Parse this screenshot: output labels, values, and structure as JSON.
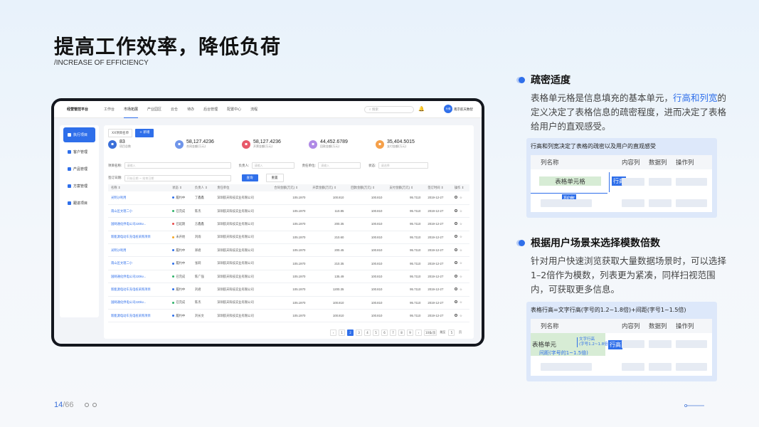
{
  "page": {
    "title": "提高工作效率，降低负荷",
    "subtitle": "/INCREASE OF EFFICIENCY",
    "page_current": "14",
    "page_total": "/66"
  },
  "app": {
    "brand": "经营管控平台",
    "nav": [
      "工作台",
      "市场拓展",
      "产业园区",
      "云仓",
      "待办",
      "后台管理",
      "配置中心",
      "流程"
    ],
    "nav_active": 1,
    "search_placeholder": "搜索",
    "avatar_text": "头像",
    "user": "南京航天数智",
    "sidebar": [
      {
        "label": "执行项目",
        "active": true
      },
      {
        "label": "客户管理",
        "active": false
      },
      {
        "label": "产品管理",
        "active": false
      },
      {
        "label": "方案管理",
        "active": false
      },
      {
        "label": "跟进项目",
        "active": false
      }
    ],
    "btn_import": "XX项目名单",
    "btn_new": "+ 新增",
    "stats": [
      {
        "value": "83",
        "label": "项目总数",
        "color": "#3a6fd9",
        "icon": "doc-icon"
      },
      {
        "value": "58,127.4236",
        "label": "合同金额(万元)",
        "color": "#6f95ea",
        "icon": "coin-icon"
      },
      {
        "value": "58,127.4236",
        "label": "开票金额(万元)",
        "color": "#e8596a",
        "icon": "ticket-icon"
      },
      {
        "value": "44,452.6789",
        "label": "回款金额(万元)",
        "color": "#b08ae6",
        "icon": "wallet-icon"
      },
      {
        "value": "35,404.5015",
        "label": "支付金额(万元)",
        "color": "#f5a04a",
        "icon": "pay-icon"
      }
    ],
    "filters": {
      "name_label": "项目名称:",
      "name_ph": "请输入",
      "owner_label": "负责人:",
      "owner_ph": "请输入",
      "unit_label": "责任单位:",
      "unit_ph": "请输入",
      "status_label": "状态:",
      "status_ph": "请选择",
      "date_label": "签订日期:",
      "date_ph": "开始日期 ~ 结束日期",
      "query": "查询",
      "reset": "重置"
    },
    "columns": [
      "名称 ⇕",
      "状态 ⇕",
      "负责人 ⇕",
      "责任单位",
      "合同金额(万元) ⇕",
      "开票金额(万元) ⇕",
      "回款金额(万元) ⇕",
      "支付金额(万元) ⇕",
      "签订时间 ⇕",
      "操作 ⇕"
    ],
    "rows": [
      [
        "光明沙利用",
        "履约中",
        "丁鑫鑫",
        "深圳航天科技实业有限公司",
        "105.1970",
        "100.810",
        "100.810",
        "95.7110",
        "2019-12-27"
      ],
      [
        "南山区文理二小",
        "已完成",
        "陈杰",
        "深圳航天科技实业有限公司",
        "105.1970",
        "110.85",
        "100.810",
        "95.7110",
        "2019-12-27"
      ],
      [
        "国网通化供电公司220kv...",
        "已延期",
        "方鑫鑫",
        "深圳航天科技实业有限公司",
        "105.1970",
        "200.35",
        "100.810",
        "95.7110",
        "2019-12-27"
      ],
      [
        "新能源电动车充电桩采购项目",
        "未开始",
        "刘雨",
        "深圳航天科技实业有限公司",
        "105.1970",
        "210.60",
        "100.810",
        "95.7110",
        "2019-12-27"
      ],
      [
        "光明沙利用",
        "履约中",
        "郑君",
        "深圳航天科技实业有限公司",
        "105.1970",
        "200.45",
        "100.810",
        "95.7110",
        "2019-12-27"
      ],
      [
        "南山区文理二小",
        "履约中",
        "张莉",
        "深圳航天科技实业有限公司",
        "105.1970",
        "210.35",
        "100.810",
        "95.7110",
        "2019-12-27"
      ],
      [
        "国网通化供电公司220kv...",
        "已完成",
        "陈广强",
        "深圳航天科技实业有限公司",
        "105.1970",
        "135.49",
        "100.810",
        "95.7110",
        "2019-12-27"
      ],
      [
        "新能源电动车充电桩采购项目",
        "履约中",
        "刘君",
        "深圳航天科技实业有限公司",
        "105.1970",
        "1200.35",
        "100.810",
        "95.7110",
        "2019-12-27"
      ],
      [
        "国网通化供电公司220kv...",
        "已完成",
        "陈杰",
        "深圳航天科技实业有限公司",
        "105.1970",
        "100.810",
        "100.810",
        "95.7110",
        "2019-12-27"
      ],
      [
        "新能源电动车充电桩采购项目",
        "履约中",
        "刘长文",
        "深圳航天科技实业有限公司",
        "105.1970",
        "100.810",
        "100.810",
        "95.7110",
        "2019-12-27"
      ]
    ],
    "status_colors": {
      "履约中": "#2f6fea",
      "已完成": "#31b36b",
      "已延期": "#e84a4a",
      "未开始": "#f5a623"
    },
    "pager": [
      "‹",
      "1",
      "2",
      "3",
      "4",
      "5",
      "6",
      "7",
      "8",
      "9",
      "›",
      "10条/页",
      "跳至",
      "5",
      "页"
    ],
    "pager_active": "2"
  },
  "sections": [
    {
      "heading": "疏密适度",
      "text_a": "表格单元格是信息填充的基本单元，",
      "text_hl": "行高和列宽",
      "text_b": "的定义决定了表格信息的疏密程度，进而决定了表格给用户的直观感受。",
      "illus": {
        "caption": "行高和列宽决定了表格的疏密以及用户的直观感受",
        "cols": [
          "列名称",
          "内容列",
          "数据列",
          "操作列"
        ],
        "cell": "表格单元格",
        "row_tag": "行高",
        "col_tag": "列宽"
      }
    },
    {
      "heading": "根据用户场景来选择模数倍数",
      "text": "针对用户快速浏览获取大量数据场景时，可以选择1–2倍作为模数，列表更为紧凑，同样扫视范围内，可获取更多信息。",
      "illus": {
        "caption": "表格行高=文字行高(字号的1.2~1.8倍)+间距(字号1~1.5倍)",
        "cols": [
          "列名称",
          "内容列",
          "数据列",
          "操作列"
        ],
        "cell": "表格单元",
        "text_line_1": "文字行高",
        "text_line_2": "(字号1.2~1.8倍)",
        "spacing": "间距(字号的1~1.5倍)",
        "row_tag": "行高"
      }
    }
  ]
}
